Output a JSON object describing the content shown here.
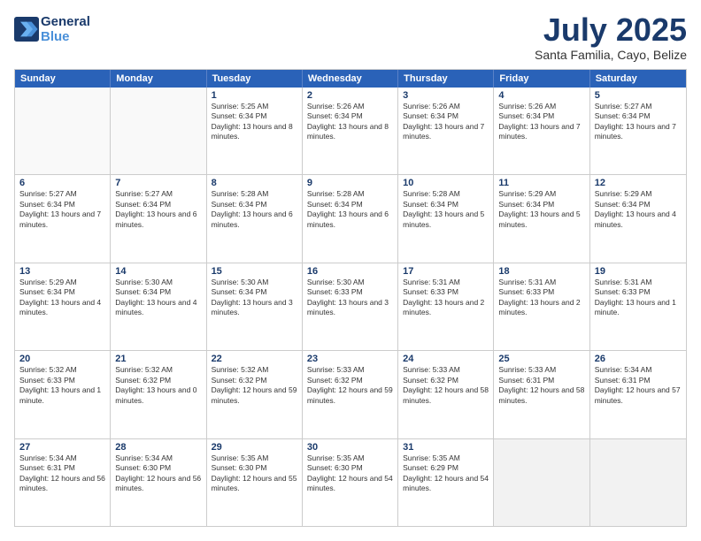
{
  "logo": {
    "line1": "General",
    "line2": "Blue"
  },
  "title": "July 2025",
  "subtitle": "Santa Familia, Cayo, Belize",
  "days_header": [
    "Sunday",
    "Monday",
    "Tuesday",
    "Wednesday",
    "Thursday",
    "Friday",
    "Saturday"
  ],
  "weeks": [
    [
      {
        "day": "",
        "detail": "",
        "empty": true
      },
      {
        "day": "",
        "detail": "",
        "empty": true
      },
      {
        "day": "1",
        "detail": "Sunrise: 5:25 AM\nSunset: 6:34 PM\nDaylight: 13 hours and 8 minutes."
      },
      {
        "day": "2",
        "detail": "Sunrise: 5:26 AM\nSunset: 6:34 PM\nDaylight: 13 hours and 8 minutes."
      },
      {
        "day": "3",
        "detail": "Sunrise: 5:26 AM\nSunset: 6:34 PM\nDaylight: 13 hours and 7 minutes."
      },
      {
        "day": "4",
        "detail": "Sunrise: 5:26 AM\nSunset: 6:34 PM\nDaylight: 13 hours and 7 minutes."
      },
      {
        "day": "5",
        "detail": "Sunrise: 5:27 AM\nSunset: 6:34 PM\nDaylight: 13 hours and 7 minutes."
      }
    ],
    [
      {
        "day": "6",
        "detail": "Sunrise: 5:27 AM\nSunset: 6:34 PM\nDaylight: 13 hours and 7 minutes."
      },
      {
        "day": "7",
        "detail": "Sunrise: 5:27 AM\nSunset: 6:34 PM\nDaylight: 13 hours and 6 minutes."
      },
      {
        "day": "8",
        "detail": "Sunrise: 5:28 AM\nSunset: 6:34 PM\nDaylight: 13 hours and 6 minutes."
      },
      {
        "day": "9",
        "detail": "Sunrise: 5:28 AM\nSunset: 6:34 PM\nDaylight: 13 hours and 6 minutes."
      },
      {
        "day": "10",
        "detail": "Sunrise: 5:28 AM\nSunset: 6:34 PM\nDaylight: 13 hours and 5 minutes."
      },
      {
        "day": "11",
        "detail": "Sunrise: 5:29 AM\nSunset: 6:34 PM\nDaylight: 13 hours and 5 minutes."
      },
      {
        "day": "12",
        "detail": "Sunrise: 5:29 AM\nSunset: 6:34 PM\nDaylight: 13 hours and 4 minutes."
      }
    ],
    [
      {
        "day": "13",
        "detail": "Sunrise: 5:29 AM\nSunset: 6:34 PM\nDaylight: 13 hours and 4 minutes."
      },
      {
        "day": "14",
        "detail": "Sunrise: 5:30 AM\nSunset: 6:34 PM\nDaylight: 13 hours and 4 minutes."
      },
      {
        "day": "15",
        "detail": "Sunrise: 5:30 AM\nSunset: 6:34 PM\nDaylight: 13 hours and 3 minutes."
      },
      {
        "day": "16",
        "detail": "Sunrise: 5:30 AM\nSunset: 6:33 PM\nDaylight: 13 hours and 3 minutes."
      },
      {
        "day": "17",
        "detail": "Sunrise: 5:31 AM\nSunset: 6:33 PM\nDaylight: 13 hours and 2 minutes."
      },
      {
        "day": "18",
        "detail": "Sunrise: 5:31 AM\nSunset: 6:33 PM\nDaylight: 13 hours and 2 minutes."
      },
      {
        "day": "19",
        "detail": "Sunrise: 5:31 AM\nSunset: 6:33 PM\nDaylight: 13 hours and 1 minute."
      }
    ],
    [
      {
        "day": "20",
        "detail": "Sunrise: 5:32 AM\nSunset: 6:33 PM\nDaylight: 13 hours and 1 minute."
      },
      {
        "day": "21",
        "detail": "Sunrise: 5:32 AM\nSunset: 6:32 PM\nDaylight: 13 hours and 0 minutes."
      },
      {
        "day": "22",
        "detail": "Sunrise: 5:32 AM\nSunset: 6:32 PM\nDaylight: 12 hours and 59 minutes."
      },
      {
        "day": "23",
        "detail": "Sunrise: 5:33 AM\nSunset: 6:32 PM\nDaylight: 12 hours and 59 minutes."
      },
      {
        "day": "24",
        "detail": "Sunrise: 5:33 AM\nSunset: 6:32 PM\nDaylight: 12 hours and 58 minutes."
      },
      {
        "day": "25",
        "detail": "Sunrise: 5:33 AM\nSunset: 6:31 PM\nDaylight: 12 hours and 58 minutes."
      },
      {
        "day": "26",
        "detail": "Sunrise: 5:34 AM\nSunset: 6:31 PM\nDaylight: 12 hours and 57 minutes."
      }
    ],
    [
      {
        "day": "27",
        "detail": "Sunrise: 5:34 AM\nSunset: 6:31 PM\nDaylight: 12 hours and 56 minutes."
      },
      {
        "day": "28",
        "detail": "Sunrise: 5:34 AM\nSunset: 6:30 PM\nDaylight: 12 hours and 56 minutes."
      },
      {
        "day": "29",
        "detail": "Sunrise: 5:35 AM\nSunset: 6:30 PM\nDaylight: 12 hours and 55 minutes."
      },
      {
        "day": "30",
        "detail": "Sunrise: 5:35 AM\nSunset: 6:30 PM\nDaylight: 12 hours and 54 minutes."
      },
      {
        "day": "31",
        "detail": "Sunrise: 5:35 AM\nSunset: 6:29 PM\nDaylight: 12 hours and 54 minutes."
      },
      {
        "day": "",
        "detail": "",
        "empty": true,
        "shaded": true
      },
      {
        "day": "",
        "detail": "",
        "empty": true,
        "shaded": true
      }
    ]
  ]
}
